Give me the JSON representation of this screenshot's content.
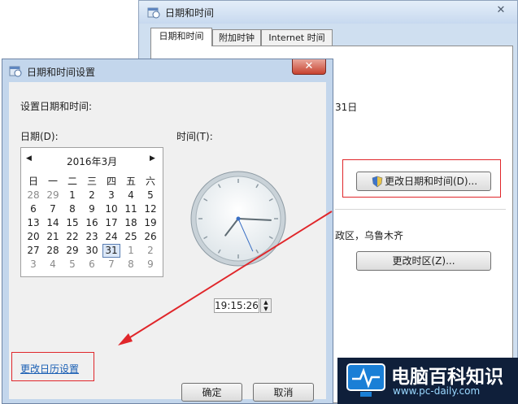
{
  "background_window": {
    "title": "日期和时间",
    "close_glyph": "✕",
    "tabs": [
      {
        "label": "日期和时间",
        "active": true
      },
      {
        "label": "附加时钟",
        "active": false
      },
      {
        "label": "Internet 时间",
        "active": false
      }
    ],
    "date_fragment": "31日",
    "change_datetime_button": "更改日期和时间(D)...",
    "timezone_fragment": "政区，乌鲁木齐",
    "change_timezone_button": "更改时区(Z)..."
  },
  "dialog": {
    "title": "日期和时间设置",
    "close_glyph": "✕",
    "intro": "设置日期和时间:",
    "date_label": "日期(D):",
    "time_label": "时间(T):",
    "calendar": {
      "month_title": "2016年3月",
      "prev_glyph": "◀",
      "next_glyph": "▶",
      "weekdays": [
        "日",
        "一",
        "二",
        "三",
        "四",
        "五",
        "六"
      ],
      "weeks": [
        [
          "28",
          "29",
          "1",
          "2",
          "3",
          "4",
          "5"
        ],
        [
          "6",
          "7",
          "8",
          "9",
          "10",
          "11",
          "12"
        ],
        [
          "13",
          "14",
          "15",
          "16",
          "17",
          "18",
          "19"
        ],
        [
          "20",
          "21",
          "22",
          "23",
          "24",
          "25",
          "26"
        ],
        [
          "27",
          "28",
          "29",
          "30",
          "31",
          "1",
          "2"
        ],
        [
          "3",
          "4",
          "5",
          "6",
          "7",
          "8",
          "9"
        ]
      ],
      "selected_day": "31"
    },
    "time_value": "19:15:26",
    "clock": {
      "hour": 19,
      "minute": 15,
      "second": 26
    },
    "change_calendar_link": "更改日历设置",
    "ok_button": "确定",
    "cancel_button": "取消"
  },
  "watermark": {
    "title": "电脑百科知识",
    "url": "www.pc-daily.com"
  },
  "colors": {
    "highlight_box": "#e0262a",
    "arrow": "#e0262a",
    "link": "#1a5fb4"
  }
}
